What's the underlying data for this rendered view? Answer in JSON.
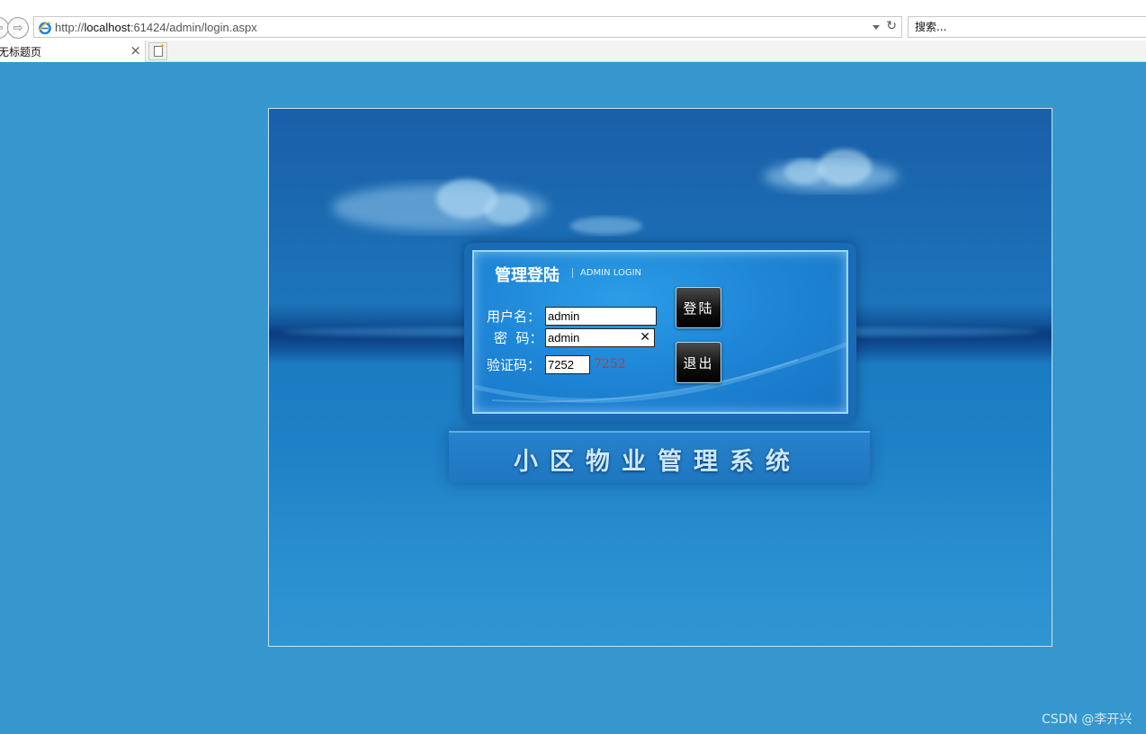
{
  "browser": {
    "url_prefix": "http://",
    "url_host": "localhost",
    "url_rest": ":61424/admin/login.aspx",
    "search_placeholder": "搜索...",
    "tab_title": "无标题页",
    "back_icon": "back-arrow-icon",
    "forward_icon": "forward-arrow-icon"
  },
  "login": {
    "title": "管理登陆",
    "subtitle": "ADMIN LOGIN",
    "username_label": "用户名：",
    "username_value": "admin",
    "password_label": "密  码：",
    "password_value": "admin",
    "captcha_label": "验证码：",
    "captcha_value": "7252",
    "captcha_display": "7252",
    "login_button": "登陆",
    "exit_button": "退出"
  },
  "system_title": "小区物业管理系统",
  "watermark": "CSDN @李开兴",
  "colors": {
    "page_bg": "#3597cd",
    "panel": "#1f86d7",
    "captcha": "#c0382b"
  }
}
